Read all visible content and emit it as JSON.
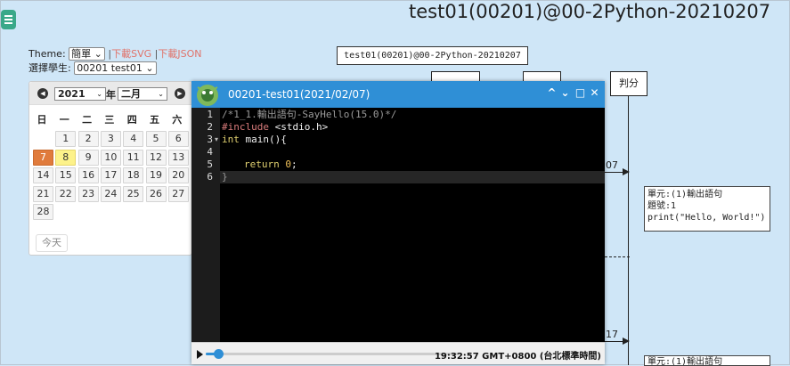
{
  "page": {
    "title": "test01(00201)@00-2Python-20210207"
  },
  "controls": {
    "theme_label": "Theme:",
    "theme_value": "簡單",
    "sep1": "|",
    "download_svg": "下載SVG",
    "sep2": "|",
    "download_json": "下載JSON",
    "student_label": "選擇學生:",
    "student_value": "00201 test01"
  },
  "calendar": {
    "year": "2021",
    "year_suffix": "年",
    "month": "二月",
    "weekdays": [
      "日",
      "一",
      "二",
      "三",
      "四",
      "五",
      "六"
    ],
    "days": [
      "1",
      "2",
      "3",
      "4",
      "5",
      "6",
      "7",
      "8",
      "9",
      "10",
      "11",
      "12",
      "13",
      "14",
      "15",
      "16",
      "17",
      "18",
      "19",
      "20",
      "21",
      "22",
      "23",
      "24",
      "25",
      "26",
      "27",
      "28"
    ],
    "first_weekday": 1,
    "selected_day": "7",
    "today_day": "8",
    "today_button": "今天",
    "prev_icon": "◀",
    "next_icon": "▶"
  },
  "diagram": {
    "title": "test01(00201)@00-2Python-20210207",
    "actor_judge": "判分",
    "message_1_num": "07",
    "message_2_num": "17",
    "note_1": "單元:(1)輸出語句\n題號:1\nprint(\"Hello, World!\")",
    "note_2": "單元:(1)輸出語句"
  },
  "window": {
    "title": "00201-test01(2021/02/07)",
    "minimize_icon": "^",
    "down_icon": "⌄",
    "maximize_icon": "□",
    "close_icon": "✕",
    "line_numbers": [
      "1",
      "2",
      "3",
      "4",
      "5",
      "6"
    ],
    "code": {
      "l1": "/*1_1.輸出語句-SayHello(15.0)*/",
      "l2_pre": "#include",
      "l2_rest": " <stdio.h>",
      "l3_key": "int",
      "l3_rest": " main(){",
      "l5_key": "return",
      "l5_num": "0",
      "l5_end": ";",
      "l6": "}"
    },
    "player_time": "19:32:57 GMT+0800 (台北標準時間)",
    "player_progress": 0.05
  },
  "colors": {
    "background": "#cfe6f7",
    "window_bar": "#2f8fd6",
    "selected_day": "#e07b3c",
    "today_day": "#fdf28a",
    "download_link": "#e0736a"
  }
}
